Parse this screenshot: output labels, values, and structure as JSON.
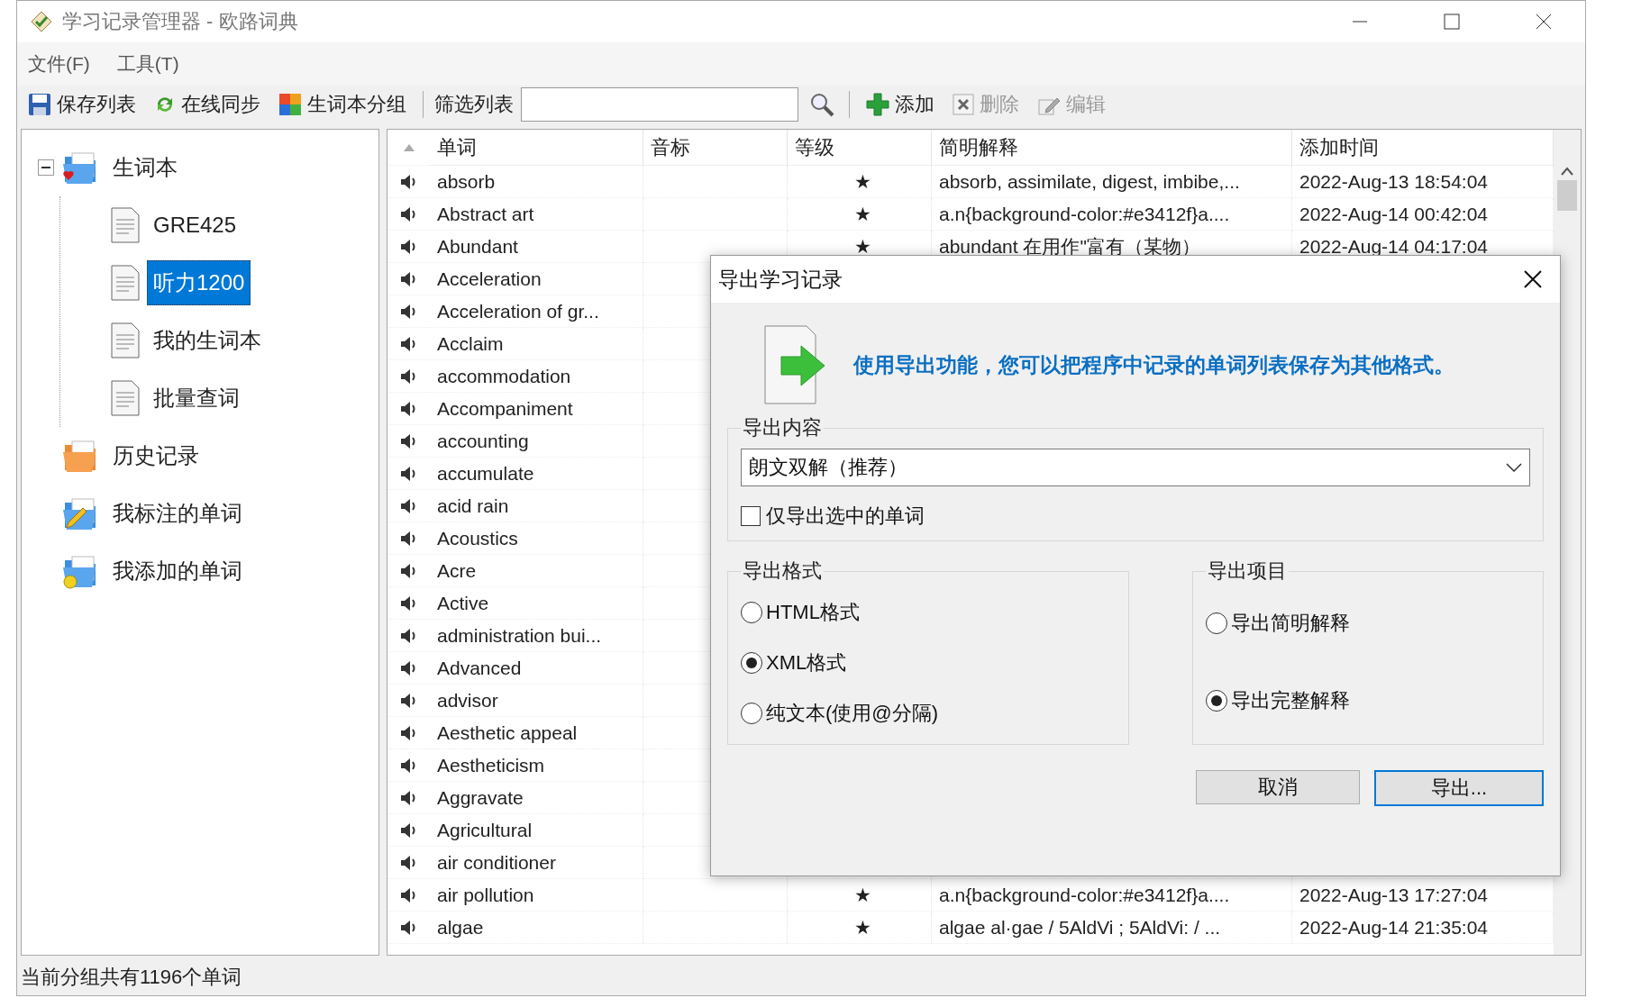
{
  "window": {
    "title": "学习记录管理器 - 欧路词典"
  },
  "menu": [
    {
      "label": "文件(F)"
    },
    {
      "label": "工具(T)"
    }
  ],
  "toolbar": {
    "left_buttons": [
      {
        "kind": "save",
        "label": "保存列表",
        "disabled": false
      },
      {
        "kind": "sync",
        "label": "在线同步",
        "disabled": false
      },
      {
        "kind": "group",
        "label": "生词本分组",
        "disabled": false
      }
    ],
    "filter": {
      "label": "筛选列表"
    },
    "right_buttons": [
      {
        "kind": "add",
        "label": "添加",
        "disabled": false
      },
      {
        "kind": "delete",
        "label": "删除",
        "disabled": true
      },
      {
        "kind": "edit",
        "label": "编辑",
        "disabled": true
      }
    ]
  },
  "tree": [
    {
      "kind": "heart",
      "label": "生词本",
      "expanded": true,
      "selected": false,
      "children": [
        {
          "kind": "doc",
          "label": "GRE425",
          "selected": false
        },
        {
          "kind": "doc",
          "label": "听力1200",
          "selected": true
        },
        {
          "kind": "doc",
          "label": "我的生词本",
          "selected": false
        },
        {
          "kind": "doc",
          "label": "批量查词",
          "selected": false
        }
      ]
    },
    {
      "kind": "history",
      "label": "历史记录",
      "selected": false
    },
    {
      "kind": "pencil",
      "label": "我标注的单词",
      "selected": false
    },
    {
      "kind": "smile",
      "label": "我添加的单词",
      "selected": false
    }
  ],
  "table": {
    "columns": [
      {
        "label": "单词"
      },
      {
        "label": "音标"
      },
      {
        "label": "等级"
      },
      {
        "label": "简明解释"
      },
      {
        "label": "添加时间"
      }
    ],
    "rows": [
      {
        "word": "absorb",
        "level": "★",
        "definition": "absorb, assimilate, digest, imbibe,...",
        "time": "2022-Aug-13 18:54:04"
      },
      {
        "word": "Abstract art",
        "level": "★",
        "definition": "a.n{background-color:#e3412f}a....",
        "time": "2022-Aug-14 00:42:04"
      },
      {
        "word": "Abundant",
        "level": "★",
        "definition": "abundant 在用作\"富有（某物）",
        "time": "2022-Aug-14 04:17:04"
      },
      {
        "word": "Acceleration"
      },
      {
        "word": "Acceleration of gr..."
      },
      {
        "word": "Acclaim"
      },
      {
        "word": "accommodation"
      },
      {
        "word": "Accompaniment"
      },
      {
        "word": "accounting"
      },
      {
        "word": "accumulate"
      },
      {
        "word": "acid rain"
      },
      {
        "word": "Acoustics"
      },
      {
        "word": "Acre"
      },
      {
        "word": "Active"
      },
      {
        "word": "administration bui..."
      },
      {
        "word": "Advanced"
      },
      {
        "word": "advisor"
      },
      {
        "word": "Aesthetic appeal"
      },
      {
        "word": "Aestheticism"
      },
      {
        "word": "Aggravate"
      },
      {
        "word": "Agricultural"
      },
      {
        "word": "air conditioner"
      },
      {
        "word": "air pollution",
        "level": "★",
        "definition": "a.n{background-color:#e3412f}a....",
        "time": "2022-Aug-13 17:27:04"
      },
      {
        "word": "algae",
        "level": "★",
        "definition": "algae  al·gae / 5AldVi ; 5AldVi: / ...",
        "time": "2022-Aug-14 21:35:04"
      }
    ]
  },
  "status_bar": "当前分组共有1196个单词",
  "dialog": {
    "title": "导出学习记录",
    "message": "使用导出功能，您可以把程序中记录的单词列表保存为其他格式。",
    "content_group": {
      "label": "导出内容",
      "select": "朗文双解（推荐）",
      "checkbox": {
        "label": "仅导出选中的单词",
        "checked": false
      }
    },
    "format_group": {
      "label": "导出格式",
      "options": [
        {
          "label": "HTML格式",
          "selected": false
        },
        {
          "label": "XML格式",
          "selected": true
        },
        {
          "label": "纯文本(使用@分隔)",
          "selected": false
        }
      ]
    },
    "items_group": {
      "label": "导出项目",
      "options": [
        {
          "label": "导出简明解释",
          "selected": false
        },
        {
          "label": "导出完整解释",
          "selected": true
        }
      ]
    },
    "buttons": [
      {
        "label": "取消",
        "default": false
      },
      {
        "label": "导出...",
        "default": true
      }
    ]
  }
}
